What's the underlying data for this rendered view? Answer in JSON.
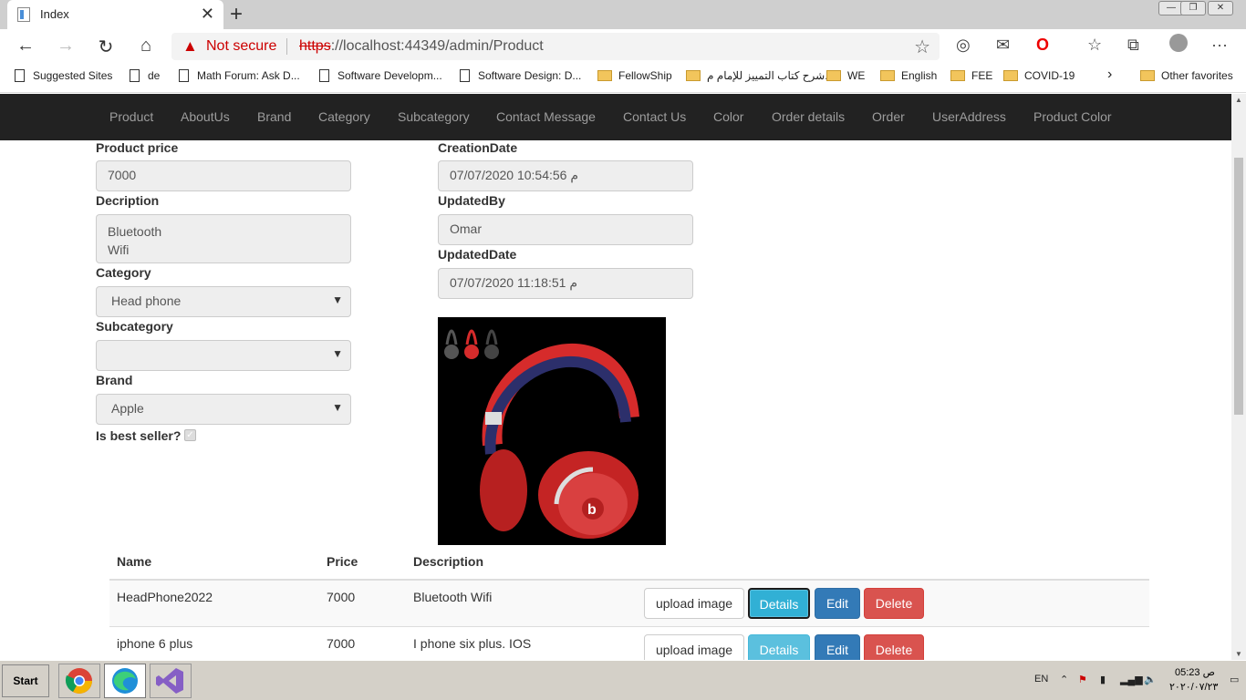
{
  "browser": {
    "tab_title": "Index",
    "tab_close": "✕",
    "new_tab": "+",
    "security_label": "Not secure",
    "url_protocol": "https",
    "url_rest": "://localhost:44349/admin/Product",
    "icons": [
      "back-icon",
      "forward-icon",
      "refresh-icon",
      "home-icon",
      "favorite-star-icon",
      "extensions-icon",
      "mail-icon",
      "opera-icon",
      "favorites-icon",
      "collections-icon",
      "profile-icon",
      "more-icon"
    ]
  },
  "favorites": [
    {
      "label": "Suggested Sites",
      "type": "page"
    },
    {
      "label": "de",
      "type": "page"
    },
    {
      "label": "Math Forum: Ask D...",
      "type": "page"
    },
    {
      "label": "Software Developm...",
      "type": "page"
    },
    {
      "label": "Software Design: D...",
      "type": "page"
    },
    {
      "label": "FellowShip",
      "type": "folder"
    },
    {
      "label": "شرح كتاب التمييز للإمام م...",
      "type": "folder"
    },
    {
      "label": "WE",
      "type": "folder"
    },
    {
      "label": "English",
      "type": "folder"
    },
    {
      "label": "FEE",
      "type": "folder"
    },
    {
      "label": "COVID-19",
      "type": "folder"
    },
    {
      "label": "Other favorites",
      "type": "folder"
    }
  ],
  "nav": [
    "Product",
    "AboutUs",
    "Brand",
    "Category",
    "Subcategory",
    "Contact Message",
    "Contact Us",
    "Color",
    "Order details",
    "Order",
    "UserAddress",
    "Product Color"
  ],
  "form": {
    "price_label": "Product price",
    "price_value": "7000",
    "description_label": "Decription",
    "description_line1": "Bluetooth",
    "description_line2": "Wifi",
    "category_label": "Category",
    "category_value": "Head phone",
    "subcategory_label": "Subcategory",
    "subcategory_value": "",
    "brand_label": "Brand",
    "brand_value": "Apple",
    "bestseller_label": "Is best seller?",
    "bestseller_checked": true,
    "creation_label": "CreationDate",
    "creation_value": "07/07/2020 10:54:56 م",
    "updatedby_label": "UpdatedBy",
    "updatedby_value": "Omar",
    "updateddate_label": "UpdatedDate",
    "updateddate_value": "07/07/2020 11:18:51 م"
  },
  "table": {
    "headers": {
      "name": "Name",
      "price": "Price",
      "description": "Description"
    },
    "rows": [
      {
        "name": "HeadPhone2022",
        "price": "7000",
        "description": "Bluetooth Wifi"
      },
      {
        "name": "iphone 6 plus",
        "price": "7000",
        "description": "I phone six plus. IOS"
      }
    ],
    "buttons": {
      "upload": "upload image",
      "details": "Details",
      "edit": "Edit",
      "delete": "Delete"
    }
  },
  "taskbar": {
    "start": "Start",
    "lang": "EN",
    "time": "05:23 ص",
    "date": "٢٠٢٠/٠٧/٢٣"
  },
  "colors": {
    "navbar": "#222222",
    "info": "#5bc0de",
    "primary": "#337ab7",
    "danger": "#d9534f",
    "headphone_red": "#d62b2b",
    "headband_navy": "#2c2f6b"
  }
}
